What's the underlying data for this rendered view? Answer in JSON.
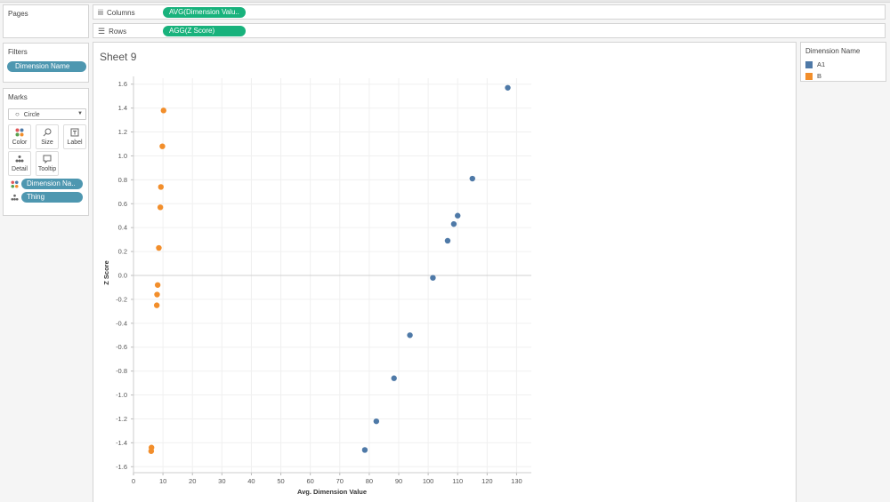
{
  "pages_card": {
    "title": "Pages"
  },
  "filters_card": {
    "title": "Filters",
    "pill": "Dimension Name"
  },
  "marks_card": {
    "title": "Marks",
    "mark_type": "Circle",
    "buttons": {
      "color": "Color",
      "size": "Size",
      "label": "Label",
      "detail": "Detail",
      "tooltip": "Tooltip"
    },
    "pills": {
      "color_field": "Dimension Na..",
      "detail_field": "Thing"
    }
  },
  "columns_shelf": {
    "label": "Columns",
    "pill": "AVG(Dimension Valu.."
  },
  "rows_shelf": {
    "label": "Rows",
    "pill": "AGG(Z Score)"
  },
  "legend": {
    "title": "Dimension Name",
    "items": [
      {
        "label": "A1",
        "color": "#4e79a7"
      },
      {
        "label": "B",
        "color": "#f28e2b"
      }
    ]
  },
  "sheet": {
    "title": "Sheet 9"
  },
  "chart_data": {
    "type": "scatter",
    "xlabel": "Avg. Dimension Value",
    "ylabel": "Z Score",
    "xlim": [
      0,
      135
    ],
    "ylim": [
      -1.65,
      1.65
    ],
    "x_ticks": [
      0,
      10,
      20,
      30,
      40,
      50,
      60,
      70,
      80,
      90,
      100,
      110,
      120,
      130
    ],
    "y_ticks": [
      1.6,
      1.4,
      1.2,
      1.0,
      0.8,
      0.6,
      0.4,
      0.2,
      0.0,
      -0.2,
      -0.4,
      -0.6,
      -0.8,
      -1.0,
      -1.2,
      -1.4,
      -1.6
    ],
    "y_tick_labels": [
      "1.6",
      "1.4",
      "1.2",
      "1.0",
      "0.8",
      "0.6",
      "0.4",
      "0.2",
      "0.0",
      "-0.2",
      "-0.4",
      "-0.6",
      "-0.8",
      "-1.0",
      "-1.2",
      "-1.4",
      "-1.6"
    ],
    "grid": true,
    "legend_placement": "right",
    "series": [
      {
        "name": "A1",
        "color": "#4e79a7",
        "points": [
          {
            "x": 127.0,
            "y": 1.57
          },
          {
            "x": 115.0,
            "y": 0.81
          },
          {
            "x": 110.0,
            "y": 0.5
          },
          {
            "x": 108.7,
            "y": 0.43
          },
          {
            "x": 106.6,
            "y": 0.29
          },
          {
            "x": 101.6,
            "y": -0.02
          },
          {
            "x": 93.8,
            "y": -0.5
          },
          {
            "x": 88.4,
            "y": -0.86
          },
          {
            "x": 82.4,
            "y": -1.22
          },
          {
            "x": 78.5,
            "y": -1.46
          }
        ]
      },
      {
        "name": "B",
        "color": "#f28e2b",
        "points": [
          {
            "x": 10.2,
            "y": 1.38
          },
          {
            "x": 9.8,
            "y": 1.08
          },
          {
            "x": 9.3,
            "y": 0.74
          },
          {
            "x": 9.1,
            "y": 0.57
          },
          {
            "x": 8.6,
            "y": 0.23
          },
          {
            "x": 8.2,
            "y": -0.08
          },
          {
            "x": 8.0,
            "y": -0.16
          },
          {
            "x": 7.9,
            "y": -0.25
          },
          {
            "x": 6.1,
            "y": -1.44
          },
          {
            "x": 6.0,
            "y": -1.47
          }
        ]
      }
    ]
  }
}
